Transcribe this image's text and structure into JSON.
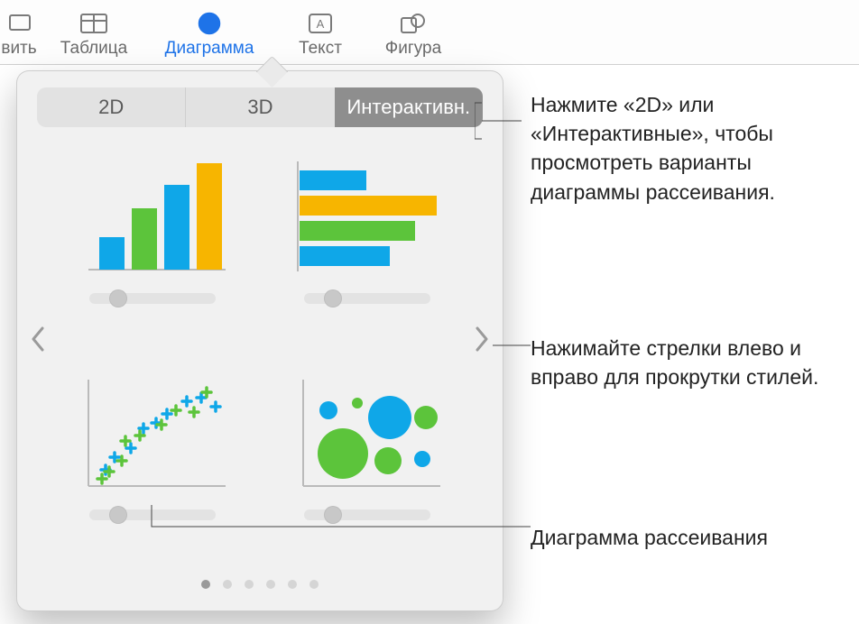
{
  "toolbar": {
    "items": [
      {
        "label": "вить"
      },
      {
        "label": "Таблица"
      },
      {
        "label": "Диаграмма"
      },
      {
        "label": "Текст"
      },
      {
        "label": "Фигура"
      }
    ]
  },
  "popover": {
    "segments": {
      "twoD": "2D",
      "threeD": "3D",
      "interactive": "Интерактивн."
    },
    "page_count": 6,
    "current_page": 1
  },
  "callouts": {
    "seg": "Нажмите «2D» или «Интерактивные», чтобы просмотреть варианты диаграммы рассеивания.",
    "arrows": "Нажимайте стрелки влево и вправо для прокрутки стилей.",
    "scatter": "Диаграмма рассеивания"
  }
}
